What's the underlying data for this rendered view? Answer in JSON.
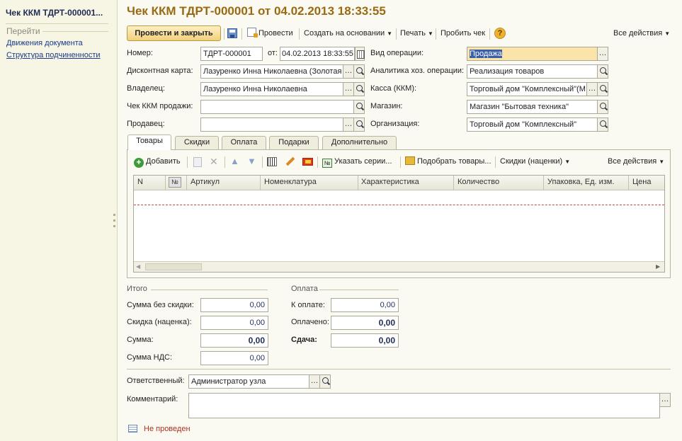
{
  "window": {
    "title": "Чек ККМ ТДРТ-000001 от 04.02.2013 18:33:55"
  },
  "sidebar": {
    "title": "Чек ККМ ТДРТ-000001...",
    "goto_header": "Перейти",
    "links": [
      "Движения документа",
      "Структура подчиненности"
    ]
  },
  "toolbar": {
    "post_close": "Провести и закрыть",
    "post": "Провести",
    "create_based": "Создать на основании",
    "print": "Печать",
    "punch": "Пробить чек",
    "all_actions": "Все действия"
  },
  "form": {
    "number_label": "Номер:",
    "number": "ТДРТ-000001",
    "date_label": "от:",
    "date": "04.02.2013 18:33:55",
    "optype_label": "Вид операции:",
    "optype": "Продажа",
    "card_label": "Дисконтная карта:",
    "card": "Лазуренко Инна Николаевна (Золотая",
    "analytics_label": "Аналитика хоз. операции:",
    "analytics": "Реализация товаров",
    "owner_label": "Владелец:",
    "owner": "Лазуренко Инна Николаевна",
    "cash_label": "Касса (ККМ):",
    "cash": "Торговый дом \"Комплексный\"(М",
    "sale_check_label": "Чек ККМ продажи:",
    "sale_check": "",
    "store_label": "Магазин:",
    "store": "Магазин \"Бытовая техника\"",
    "seller_label": "Продавец:",
    "seller": "",
    "org_label": "Организация:",
    "org": "Торговый дом \"Комплексный\""
  },
  "tabs": [
    "Товары",
    "Скидки",
    "Оплата",
    "Подарки",
    "Дополнительно"
  ],
  "goods_toolbar": {
    "add": "Добавить",
    "specify_series": "Указать серии...",
    "pick_goods": "Подобрать товары...",
    "discounts": "Скидки (наценки)",
    "all_actions": "Все действия"
  },
  "table": {
    "columns": [
      "N",
      "№",
      "Артикул",
      "Номенклатура",
      "Характеристика",
      "Количество",
      "Упаковка, Ед. изм.",
      "Цена"
    ],
    "rows": []
  },
  "totals": {
    "header": "Итого",
    "sum_no_discount_label": "Сумма без скидки:",
    "sum_no_discount": "0,00",
    "discount_label": "Скидка (наценка):",
    "discount": "0,00",
    "sum_label": "Сумма:",
    "sum": "0,00",
    "vat_label": "Сумма НДС:",
    "vat": "0,00"
  },
  "payment": {
    "header": "Оплата",
    "to_pay_label": "К оплате:",
    "to_pay": "0,00",
    "paid_label": "Оплачено:",
    "paid": "0,00",
    "change_label": "Сдача:",
    "change": "0,00"
  },
  "footer": {
    "responsible_label": "Ответственный:",
    "responsible": "Администратор узла",
    "comment_label": "Комментарий:",
    "comment": "",
    "status": "Не проведен"
  },
  "colors": {
    "title": "#9a6a12",
    "highlight": "#fbe4a8",
    "status": "#b03020"
  }
}
